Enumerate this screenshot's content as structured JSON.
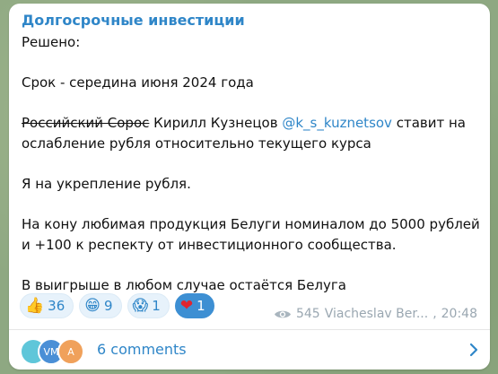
{
  "message": {
    "channel": "Долгосрочные инвестиции",
    "lines": {
      "l1": "Решено:",
      "l2": "Срок - середина июня 2024 года",
      "l3_strike": "Российский Сорос",
      "l3_name": "Кирилл Кузнецов",
      "l3_mention": "@k_s_kuznetsov",
      "l3_rest": "ставит на",
      "l4": "ослабление рубля относительно текущего курса",
      "l5": "Я на укрепление рубля.",
      "l6": "На кону любимая продукция Белуги номиналом до 5000 рублей",
      "l7": "и +100 к респекту от инвестиционного сообщества.",
      "l8": "В выигрыше в любом случае остаётся Белуга"
    },
    "reactions": [
      {
        "emoji": "👍",
        "count": "36",
        "icon": "thumbs-up-icon"
      },
      {
        "emoji": "😁",
        "count": "9",
        "icon": "grin-icon"
      },
      {
        "emoji": "😱",
        "count": "1",
        "icon": "scream-icon"
      },
      {
        "emoji": "❤",
        "count": "1",
        "icon": "heart-icon",
        "active": true
      }
    ],
    "views": "545",
    "author": "Viacheslav Ber...",
    "time": "20:48"
  },
  "comments": {
    "label": "6 comments",
    "avatars": [
      "",
      "VM",
      "A"
    ],
    "avatar_colors": [
      "#5fc6d9",
      "#4a8fd6",
      "#f0a15b"
    ]
  },
  "colors": {
    "accent": "#2f86c8",
    "reaction_bg": "#e7f2fb",
    "active_reaction": "#3d8fd3",
    "heart": "#e0242f"
  }
}
